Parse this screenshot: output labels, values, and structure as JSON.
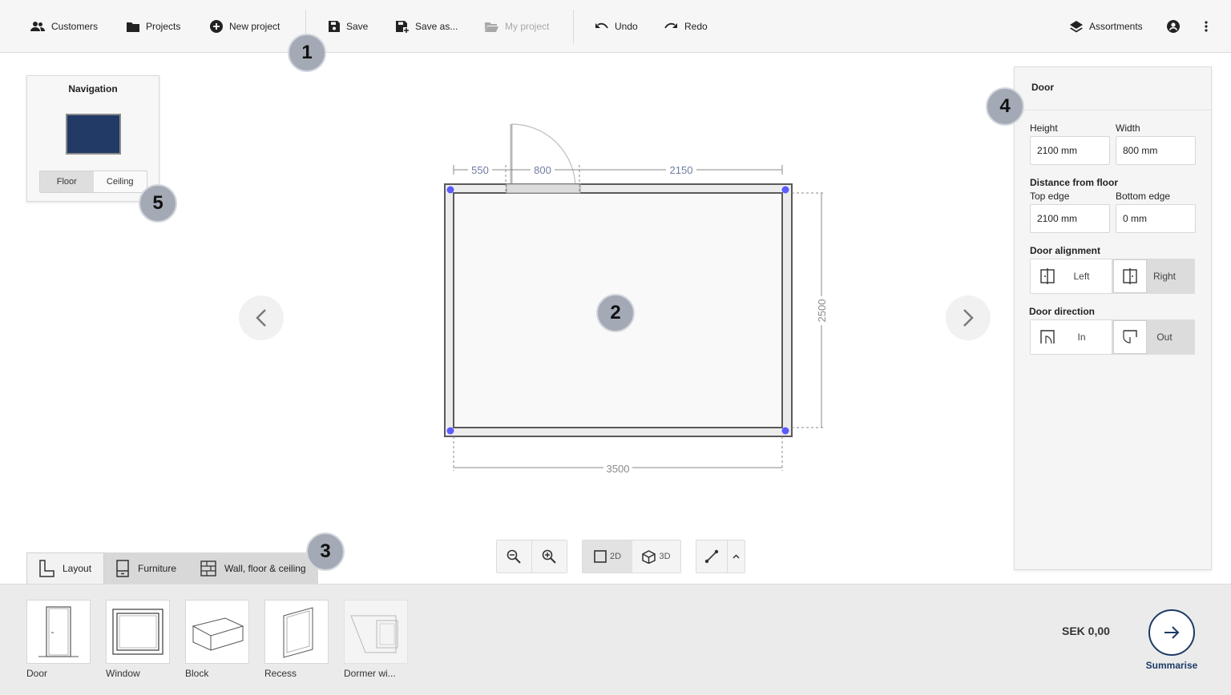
{
  "toolbar": {
    "customers": "Customers",
    "projects": "Projects",
    "new_project": "New project",
    "save": "Save",
    "save_as": "Save as...",
    "my_project": "My project",
    "undo": "Undo",
    "redo": "Redo",
    "assortments": "Assortments"
  },
  "markers": [
    "1",
    "2",
    "3",
    "4",
    "5"
  ],
  "navigation": {
    "title": "Navigation",
    "floor": "Floor",
    "ceiling": "Ceiling"
  },
  "plan": {
    "dim_left": "550",
    "dim_door": "800",
    "dim_right": "2150",
    "dim_bottom": "3500",
    "dim_side": "2500"
  },
  "door_panel": {
    "title": "Door",
    "height_label": "Height",
    "height_value": "2100 mm",
    "width_label": "Width",
    "width_value": "800 mm",
    "distance_label": "Distance from floor",
    "top_edge_label": "Top edge",
    "top_edge_value": "2100 mm",
    "bottom_edge_label": "Bottom edge",
    "bottom_edge_value": "0 mm",
    "alignment_label": "Door alignment",
    "align_left": "Left",
    "align_right": "Right",
    "direction_label": "Door direction",
    "dir_in": "In",
    "dir_out": "Out"
  },
  "tabs": {
    "layout": "Layout",
    "furniture": "Furniture",
    "wall": "Wall, floor & ceiling"
  },
  "view": {
    "mode_2d": "2D",
    "mode_3d": "3D"
  },
  "palette": {
    "items": [
      "Door",
      "Window",
      "Block",
      "Recess",
      "Dormer wi..."
    ],
    "price": "SEK 0,00",
    "summarise": "Summarise"
  },
  "colors": {
    "accent": "#1e3a66",
    "marker": "#a3a9b5",
    "handle": "#5b5bff"
  }
}
